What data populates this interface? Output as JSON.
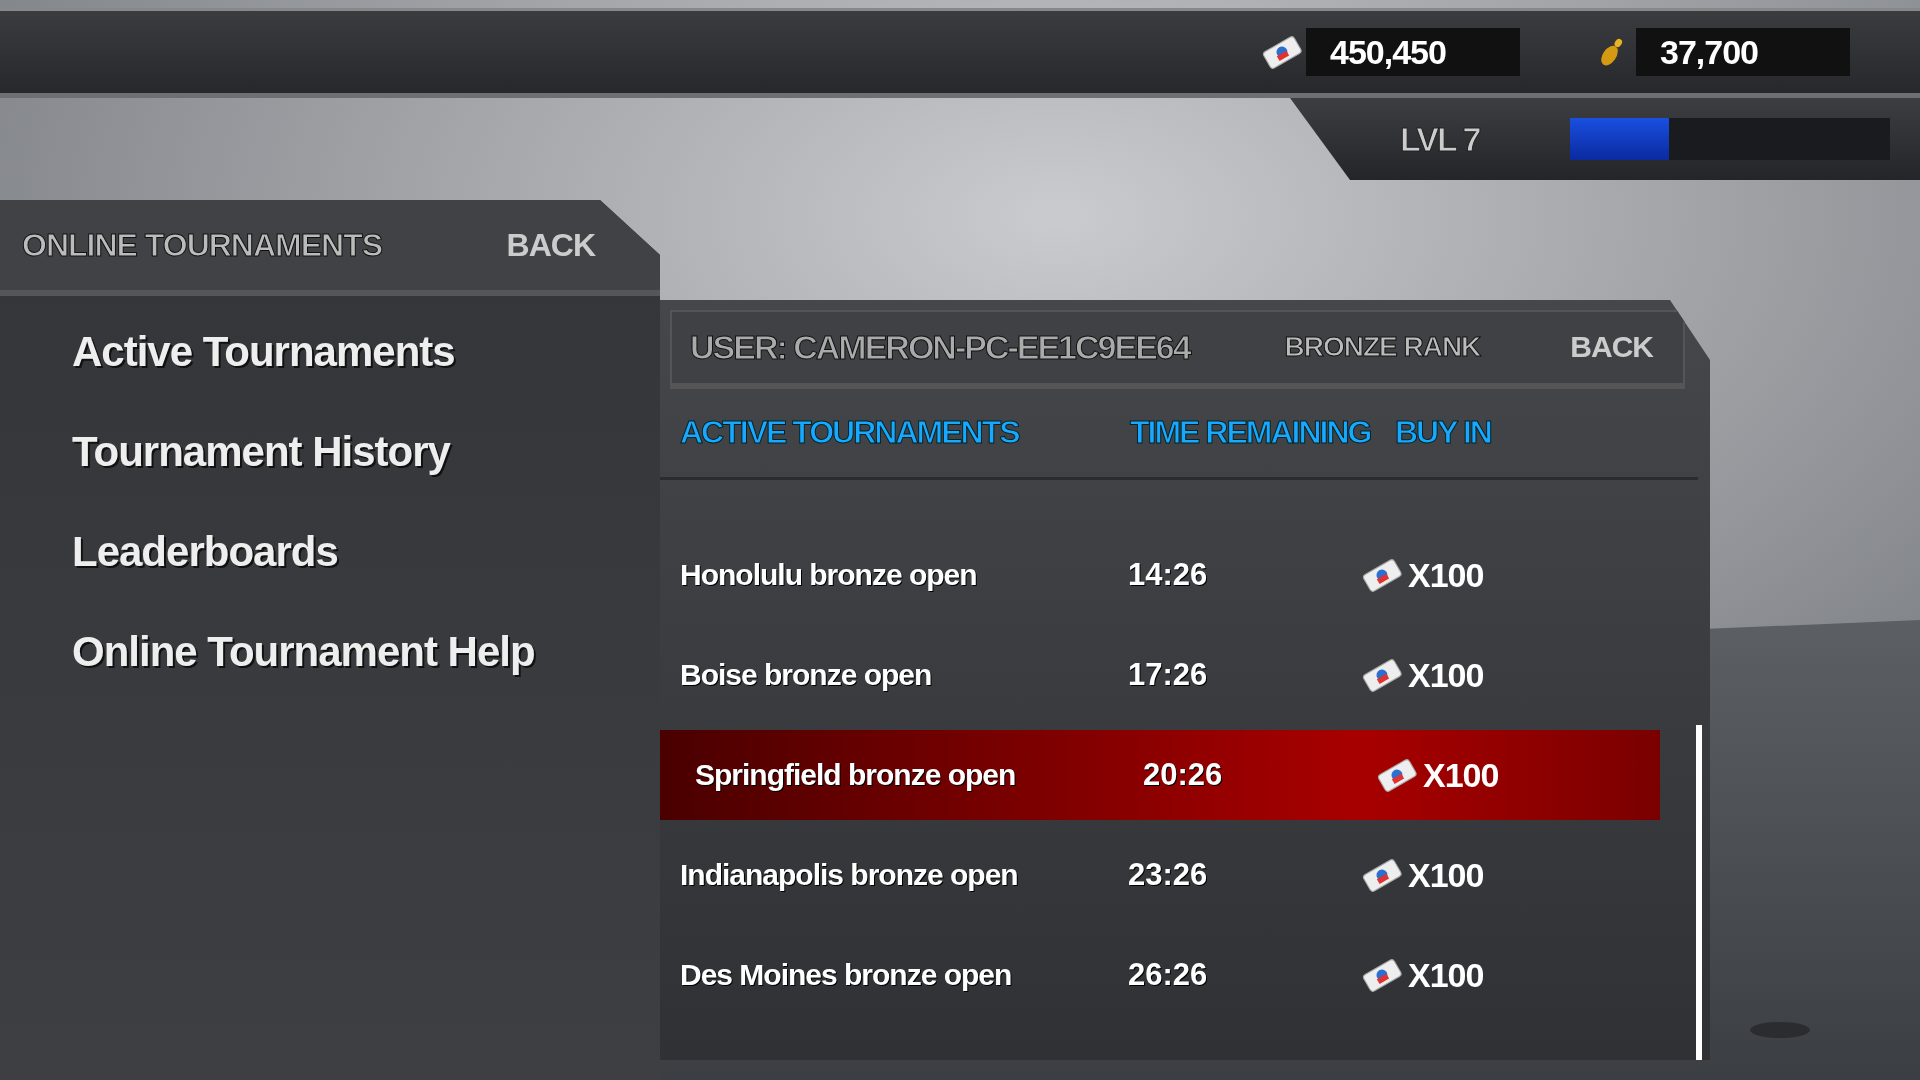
{
  "currencies": [
    {
      "kind": "ticket",
      "amount": "450,450"
    },
    {
      "kind": "pin",
      "amount": "37,700"
    }
  ],
  "level": {
    "label": "LVL 7",
    "level": 0.31
  },
  "menu": {
    "title": "ONLINE TOURNAMENTS",
    "back": "BACK",
    "items": [
      {
        "label": "Active Tournaments"
      },
      {
        "label": "Tournament History"
      },
      {
        "label": "Leaderboards"
      },
      {
        "label": "Online Tournament Help"
      }
    ]
  },
  "panel": {
    "user": "USER: CAMERON-PC-EE1C9EE64",
    "rank": "BRONZE RANK",
    "back": "BACK",
    "columns": [
      "ACTIVE TOURNAMENTS",
      "TIME REMAINING",
      "BUY IN"
    ],
    "rows": [
      {
        "name": "Honolulu bronze open",
        "time": "14:26",
        "buy_in": "X100",
        "selected": false
      },
      {
        "name": "Boise bronze open",
        "time": "17:26",
        "buy_in": "X100",
        "selected": false
      },
      {
        "name": "Springfield bronze open",
        "time": "20:26",
        "buy_in": "X100",
        "selected": true
      },
      {
        "name": "Indianapolis bronze open",
        "time": "23:26",
        "buy_in": "X100",
        "selected": false
      },
      {
        "name": "Des Moines bronze open",
        "time": "26:26",
        "buy_in": "X100",
        "selected": false
      }
    ]
  }
}
